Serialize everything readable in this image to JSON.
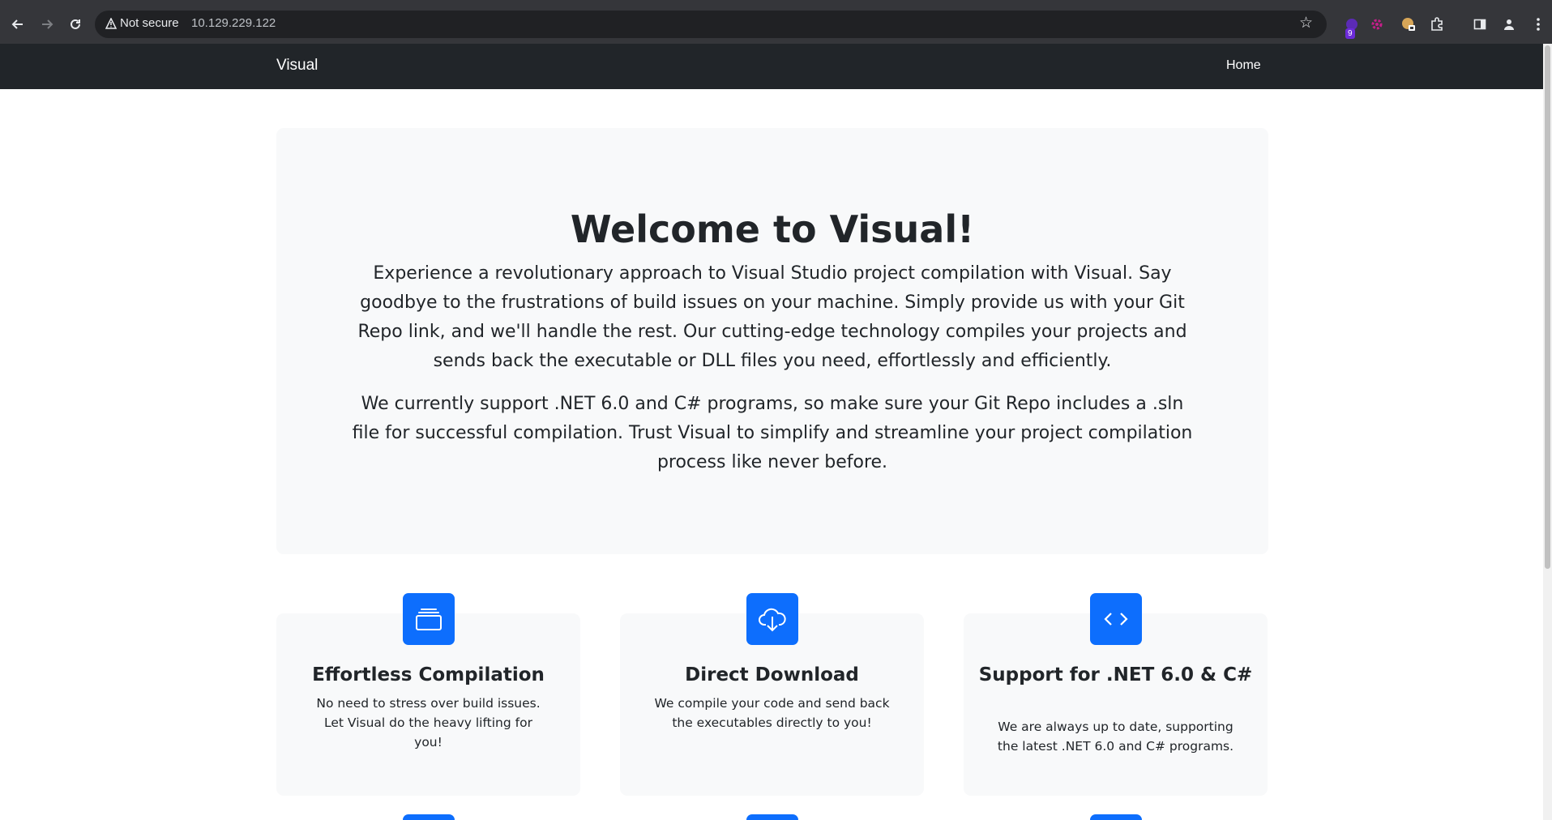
{
  "browser": {
    "security_label": "Not secure",
    "url": "10.129.229.122",
    "extension_badge": "9"
  },
  "navbar": {
    "brand": "Visual",
    "links": [
      {
        "label": "Home"
      }
    ]
  },
  "hero": {
    "title": "Welcome to Visual!",
    "paragraph1": "Experience a revolutionary approach to Visual Studio project compilation with Visual. Say goodbye to the frustrations of build issues on your machine. Simply provide us with your Git Repo link, and we'll handle the rest. Our cutting-edge technology compiles your projects and sends back the executable or DLL files you need, effortlessly and efficiently.",
    "paragraph2": "We currently support .NET 6.0 and C# programs, so make sure your Git Repo includes a .sln file for successful compilation. Trust Visual to simplify and streamline your project compilation process like never before."
  },
  "features": [
    {
      "icon": "collection-icon",
      "title": "Effortless Compilation",
      "description": "No need to stress over build issues. Let Visual do the heavy lifting for you!"
    },
    {
      "icon": "cloud-download-icon",
      "title": "Direct Download",
      "description": "We compile your code and send back the executables directly to you!"
    },
    {
      "icon": "code-icon",
      "title": "Support for .NET 6.0 & C#",
      "description": "We are always up to date, supporting the latest .NET 6.0 and C# programs."
    }
  ],
  "colors": {
    "navbar_bg": "#212529",
    "hero_bg": "#f8f9fa",
    "accent": "#0d6efd"
  }
}
